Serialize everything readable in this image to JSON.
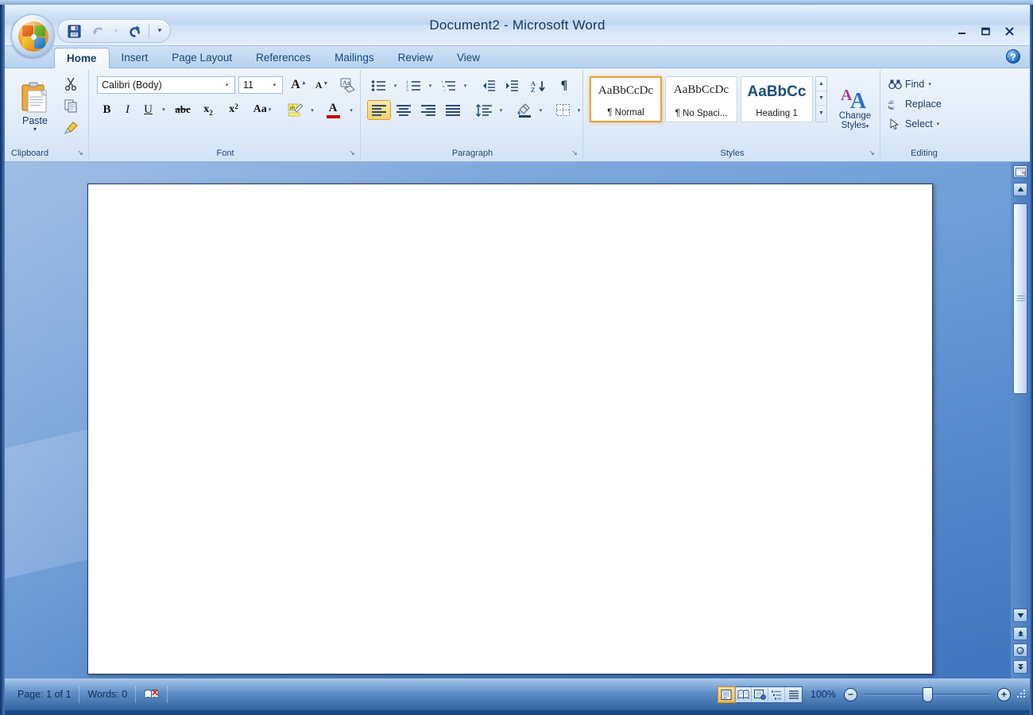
{
  "window": {
    "title": "Document2 - Microsoft Word",
    "minimize_label": "–",
    "maximize_label": "❐",
    "close_label": "✕",
    "help_label": "?"
  },
  "quick_access": {
    "items": [
      {
        "name": "save-button",
        "tooltip": "Save"
      },
      {
        "name": "undo-button",
        "tooltip": "Undo"
      },
      {
        "name": "redo-button",
        "tooltip": "Redo"
      },
      {
        "name": "customize-qat-button",
        "tooltip": "Customize Quick Access Toolbar"
      }
    ]
  },
  "tabs": [
    {
      "label": "Home",
      "active": true
    },
    {
      "label": "Insert",
      "active": false
    },
    {
      "label": "Page Layout",
      "active": false
    },
    {
      "label": "References",
      "active": false
    },
    {
      "label": "Mailings",
      "active": false
    },
    {
      "label": "Review",
      "active": false
    },
    {
      "label": "View",
      "active": false
    }
  ],
  "ribbon": {
    "groups": [
      {
        "label": "Clipboard",
        "launcher": "↘"
      },
      {
        "label": "Font",
        "launcher": "↘"
      },
      {
        "label": "Paragraph",
        "launcher": "↘"
      },
      {
        "label": "Styles",
        "launcher": "↘"
      },
      {
        "label": "Editing",
        "launcher": ""
      }
    ],
    "clipboard": {
      "paste_label": "Paste",
      "paste_arrow": "▾",
      "cut_tooltip": "Cut",
      "copy_tooltip": "Copy",
      "format_painter_tooltip": "Format Painter"
    },
    "font": {
      "font_name": "Calibri (Body)",
      "font_size": "11",
      "grow_label": "A",
      "shrink_label": "A",
      "clear_label": "Aa",
      "bold_label": "B",
      "italic_label": "I",
      "underline_label": "U",
      "strike_label": "abc",
      "subscript_label": "x",
      "subscript_sub": "2",
      "superscript_label": "x",
      "superscript_sup": "2",
      "change_case_label": "Aa",
      "highlight_label": "ab",
      "font_color_label": "A",
      "dropdown_arrow": "▾",
      "highlight_color": "#ffff00",
      "font_color": "#c00000"
    },
    "paragraph": {
      "bullets_tooltip": "Bullets",
      "numbering_tooltip": "Numbering",
      "multilevel_tooltip": "Multilevel List",
      "decrease_indent_tooltip": "Decrease Indent",
      "increase_indent_tooltip": "Increase Indent",
      "sort_label": "A\nZ",
      "sort_arrow": "↓",
      "marks_label": "¶",
      "align_left_tooltip": "Align Text Left",
      "align_center_tooltip": "Center",
      "align_right_tooltip": "Align Text Right",
      "justify_tooltip": "Justify",
      "line_spacing_tooltip": "Line and Paragraph Spacing",
      "shading_tooltip": "Shading",
      "borders_tooltip": "Borders",
      "dropdown_arrow": "▾"
    },
    "styles": {
      "items": [
        {
          "preview": "AaBbCcDc",
          "name": "¶ Normal",
          "selected": true,
          "heading": false
        },
        {
          "preview": "AaBbCcDc",
          "name": "¶ No Spaci...",
          "selected": false,
          "heading": false
        },
        {
          "preview": "AaBbCс",
          "name": "Heading 1",
          "selected": false,
          "heading": true
        }
      ],
      "scroll_up": "▲",
      "scroll_down": "▼",
      "more": "▼",
      "change_styles_line1": "Change",
      "change_styles_line2": "Styles",
      "change_styles_arrow": "▾"
    },
    "editing": {
      "find_label": "Find",
      "replace_label": "Replace",
      "select_label": "Select",
      "dropdown_arrow": "▾"
    }
  },
  "document": {
    "content": ""
  },
  "scrollbar": {
    "ruler_toggle_tooltip": "View Ruler",
    "up_arrow": "▲",
    "down_arrow": "▼",
    "prev_page": "⬆",
    "browse_object": "●",
    "next_page": "⬇"
  },
  "status_bar": {
    "page": "Page: 1 of 1",
    "words": "Words: 0",
    "proofing_tooltip": "Proofing Errors",
    "zoom_percent": "100%",
    "zoom_out": "−",
    "zoom_in": "+",
    "views": [
      {
        "name": "print-layout",
        "active": true
      },
      {
        "name": "full-screen-reading",
        "active": false
      },
      {
        "name": "web-layout",
        "active": false
      },
      {
        "name": "outline",
        "active": false
      },
      {
        "name": "draft",
        "active": false
      }
    ]
  }
}
